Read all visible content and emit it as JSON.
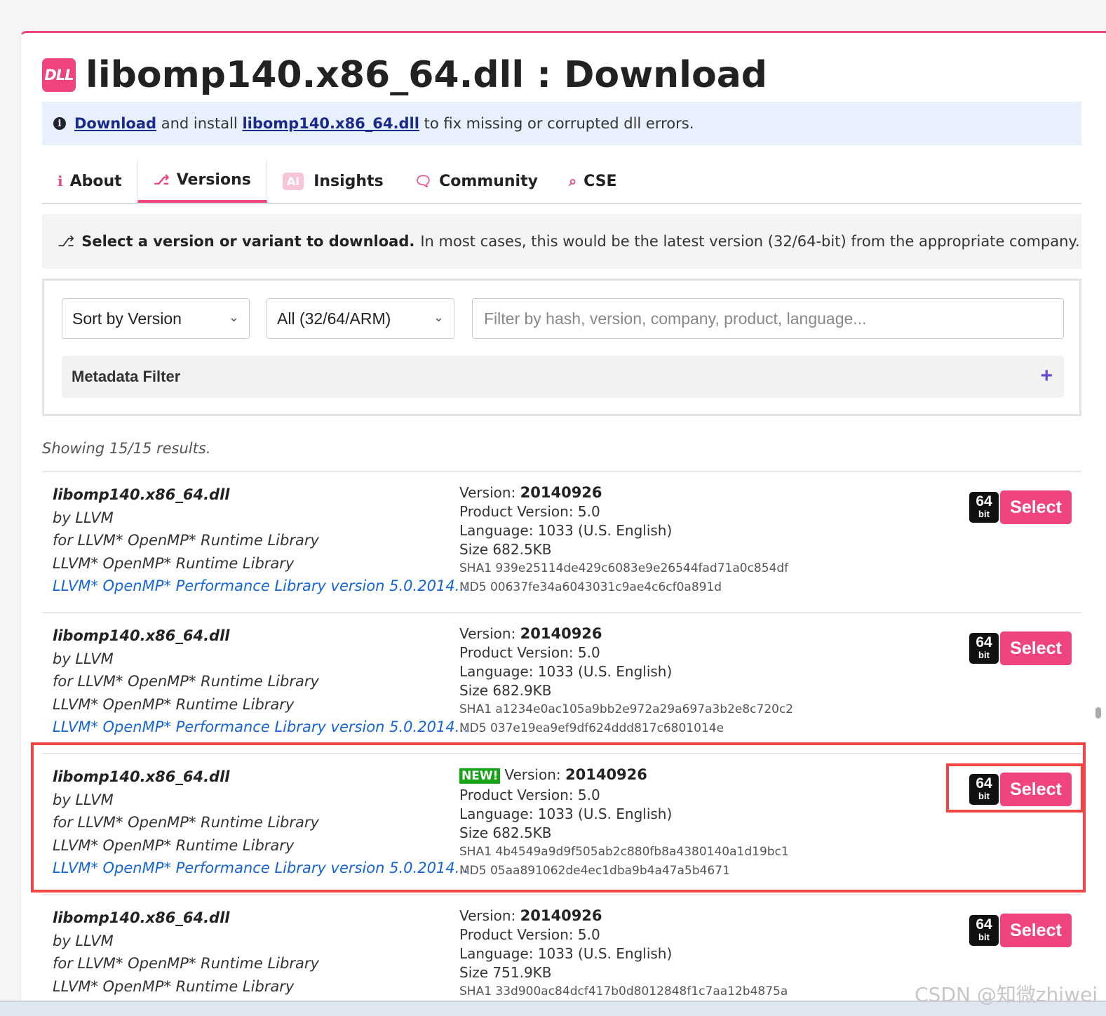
{
  "header": {
    "logo_text": "DLL",
    "title": "libomp140.x86_64.dll : Download"
  },
  "info_bar": {
    "link1": "Download",
    "text1": " and install ",
    "link2": "libomp140.x86_64.dll",
    "text2": " to fix missing or corrupted dll errors."
  },
  "tabs": [
    {
      "label": "About",
      "icon": "info-icon"
    },
    {
      "label": "Versions",
      "icon": "branch-icon"
    },
    {
      "label": "Insights",
      "badge": "AI"
    },
    {
      "label": "Community",
      "icon": "chat-icon"
    },
    {
      "label": "CSE",
      "icon": "magnify-icon"
    }
  ],
  "hint": {
    "bold": "Select a version or variant to download.",
    "text": "In most cases, this would be the latest version (32/64-bit) from the appropriate company."
  },
  "filters": {
    "sort": "Sort by Version",
    "arch": "All (32/64/ARM)",
    "search_placeholder": "Filter by hash, version, company, product, language...",
    "metadata_label": "Metadata Filter"
  },
  "showing": "Showing 15/15 results.",
  "results": [
    {
      "file": "libomp140.x86_64.dll",
      "by": "by LLVM",
      "for": "for LLVM* OpenMP* Runtime Library",
      "product": "LLVM* OpenMP* Runtime Library",
      "desc": "LLVM* OpenMP* Performance Library version 5.0.2014...",
      "version": "20140926",
      "product_version": "Product Version: 5.0",
      "language": "Language: 1033 (U.S. English)",
      "size": "Size 682.5KB",
      "sha1": "SHA1 939e25114de429c6083e9e26544fad71a0c854df",
      "md5": "MD5 00637fe34a6043031c9ae4c6cf0a891d",
      "bits": "64",
      "bit_label": "bit",
      "button": "Select"
    },
    {
      "file": "libomp140.x86_64.dll",
      "by": "by LLVM",
      "for": "for LLVM* OpenMP* Runtime Library",
      "product": "LLVM* OpenMP* Runtime Library",
      "desc": "LLVM* OpenMP* Performance Library version 5.0.2014...",
      "version": "20140926",
      "product_version": "Product Version: 5.0",
      "language": "Language: 1033 (U.S. English)",
      "size": "Size 682.9KB",
      "sha1": "SHA1 a1234e0ac105a9bb2e972a29a697a3b2e8c720c2",
      "md5": "MD5 037e19ea9ef9df624ddd817c6801014e",
      "bits": "64",
      "bit_label": "bit",
      "button": "Select"
    },
    {
      "file": "libomp140.x86_64.dll",
      "by": "by LLVM",
      "for": "for LLVM* OpenMP* Runtime Library",
      "product": "LLVM* OpenMP* Runtime Library",
      "desc": "LLVM* OpenMP* Performance Library version 5.0.2014...",
      "new": "NEW!",
      "version": "20140926",
      "product_version": "Product Version: 5.0",
      "language": "Language: 1033 (U.S. English)",
      "size": "Size 682.5KB",
      "sha1": "SHA1 4b4549a9d9f505ab2c880fb8a4380140a1d19bc1",
      "md5": "MD5 05aa891062de4ec1dba9b4a47a5b4671",
      "bits": "64",
      "bit_label": "bit",
      "button": "Select"
    },
    {
      "file": "libomp140.x86_64.dll",
      "by": "by LLVM",
      "for": "for LLVM* OpenMP* Runtime Library",
      "product": "LLVM* OpenMP* Runtime Library",
      "desc": "",
      "version": "20140926",
      "product_version": "Product Version: 5.0",
      "language": "Language: 1033 (U.S. English)",
      "size": "Size 751.9KB",
      "sha1": "SHA1 33d900ac84dcf417b0d8012848f1c7aa12b4875a",
      "md5": "",
      "bits": "64",
      "bit_label": "bit",
      "button": "Select"
    }
  ],
  "version_label": "Version: ",
  "watermark": "CSDN @知微zhiwei",
  "colors": {
    "accent": "#f0447e",
    "highlight": "#f24444",
    "link": "#1565d8",
    "new_badge": "#17a317"
  }
}
